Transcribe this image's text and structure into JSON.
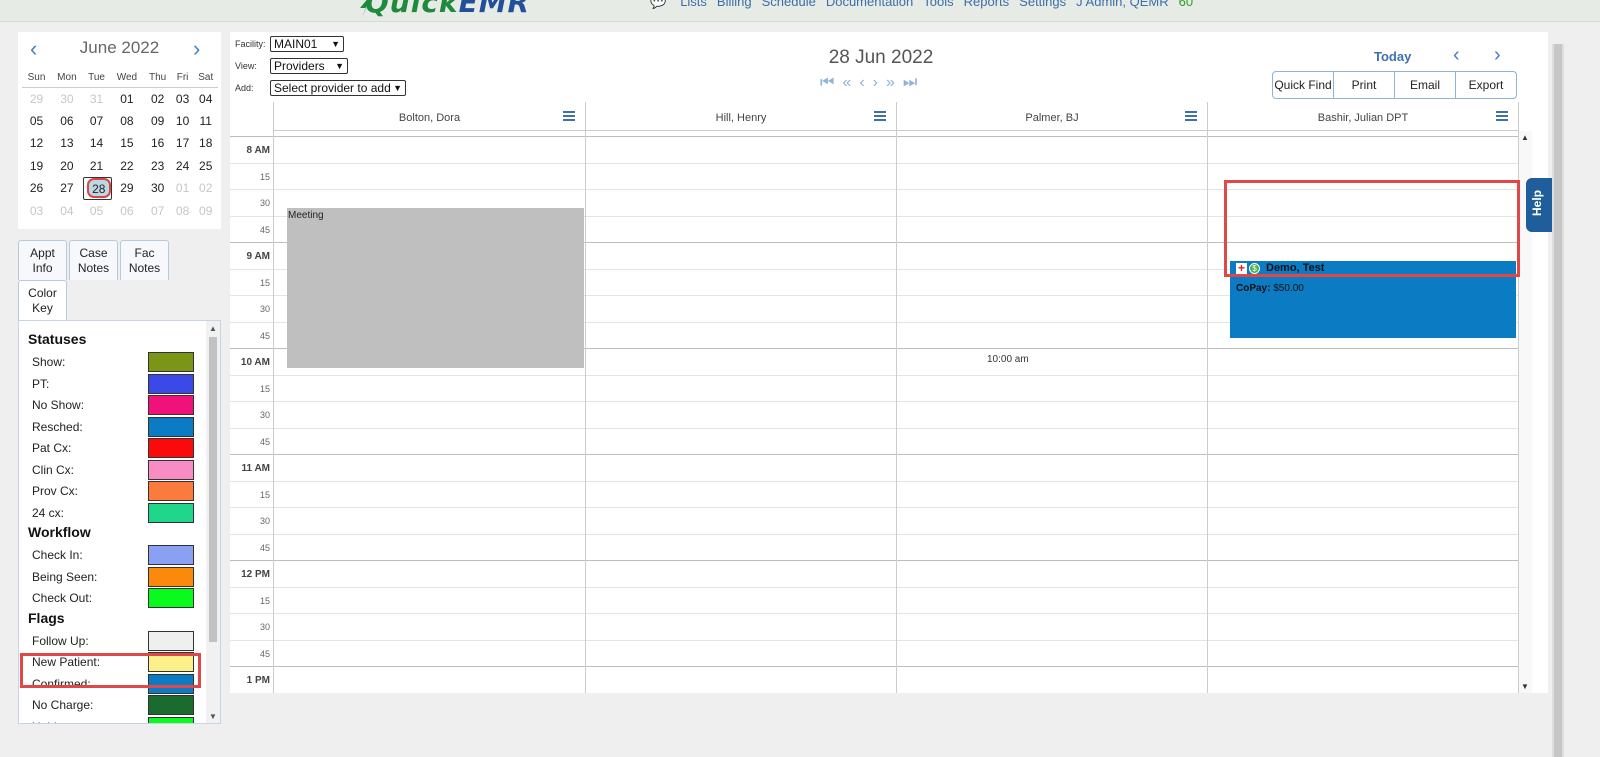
{
  "header": {
    "logo_quick": "Quick",
    "logo_emr": "EMR",
    "nav": [
      "Lists",
      "Billing",
      "Schedule",
      "Documentation",
      "Tools",
      "Reports",
      "Settings",
      "J Admin, QEMR"
    ],
    "count": "60"
  },
  "minical": {
    "month": "June 2022",
    "prev": "‹",
    "next": "›",
    "weekdays": [
      "Sun",
      "Mon",
      "Tue",
      "Wed",
      "Thu",
      "Fri",
      "Sat"
    ],
    "weeks": [
      [
        "29",
        "30",
        "31",
        "01",
        "02",
        "03",
        "04"
      ],
      [
        "05",
        "06",
        "07",
        "08",
        "09",
        "10",
        "11"
      ],
      [
        "12",
        "13",
        "14",
        "15",
        "16",
        "17",
        "18"
      ],
      [
        "19",
        "20",
        "21",
        "22",
        "23",
        "24",
        "25"
      ],
      [
        "26",
        "27",
        "28",
        "29",
        "30",
        "01",
        "02"
      ],
      [
        "03",
        "04",
        "05",
        "06",
        "07",
        "08",
        "09"
      ]
    ],
    "selected": "28"
  },
  "tabs": {
    "appt_info": "Appt\nInfo",
    "case_notes": "Case\nNotes",
    "fac_notes": "Fac\nNotes",
    "color_key": "Color\nKey"
  },
  "color_key": {
    "statuses_title": "Statuses",
    "statuses": [
      {
        "label": "Show:",
        "color": "#7b9617"
      },
      {
        "label": "PT:",
        "color": "#3b49e6"
      },
      {
        "label": "No Show:",
        "color": "#f0127a"
      },
      {
        "label": "Resched:",
        "color": "#0b7bc3"
      },
      {
        "label": "Pat Cx:",
        "color": "#fb0a0a"
      },
      {
        "label": "Clin Cx:",
        "color": "#f78dc4"
      },
      {
        "label": "Prov Cx:",
        "color": "#fa7b3c"
      },
      {
        "label": "24 cx:",
        "color": "#1fd68a"
      }
    ],
    "workflow_title": "Workflow",
    "workflow": [
      {
        "label": "Check In:",
        "color": "#8aa0f3"
      },
      {
        "label": "Being Seen:",
        "color": "#fb8a0c"
      },
      {
        "label": "Check Out:",
        "color": "#0afa1e"
      }
    ],
    "flags_title": "Flags",
    "flags": [
      {
        "label": "Follow Up:",
        "color": "#efefef"
      },
      {
        "label": "New Patient:",
        "color": "#fbf08a"
      },
      {
        "label": "Confirmed:",
        "color": "#0b7bc3"
      },
      {
        "label": "No Charge:",
        "color": "#1a6b2e"
      },
      {
        "label": "Hold:",
        "color": "#0afa1e"
      }
    ]
  },
  "controls": {
    "facility_label": "Facility:",
    "facility_value": "MAIN01",
    "view_label": "View:",
    "view_value": "Providers",
    "add_label": "Add:",
    "add_value": "Select provider to add"
  },
  "schedule": {
    "date": "28 Jun 2022",
    "today": "Today",
    "buttons": [
      "Quick Find",
      "Print",
      "Email",
      "Export"
    ],
    "providers": [
      "Bolton, Dora",
      "Hill, Henry",
      "Palmer, BJ",
      "Bashir, Julian DPT"
    ],
    "time_labels": [
      "8 AM",
      "15",
      "30",
      "45",
      "9 AM",
      "15",
      "30",
      "45",
      "10 AM",
      "15",
      "30",
      "45",
      "11 AM",
      "15",
      "30",
      "45",
      "12 PM",
      "15",
      "30",
      "45",
      "1 PM"
    ],
    "meeting_label": "Meeting",
    "appointment": {
      "name": "Demo, Test",
      "copay_label": "CoPay:",
      "copay_value": "$50.00"
    },
    "ten_am_note": "10:00 am"
  },
  "help_label": "Help"
}
